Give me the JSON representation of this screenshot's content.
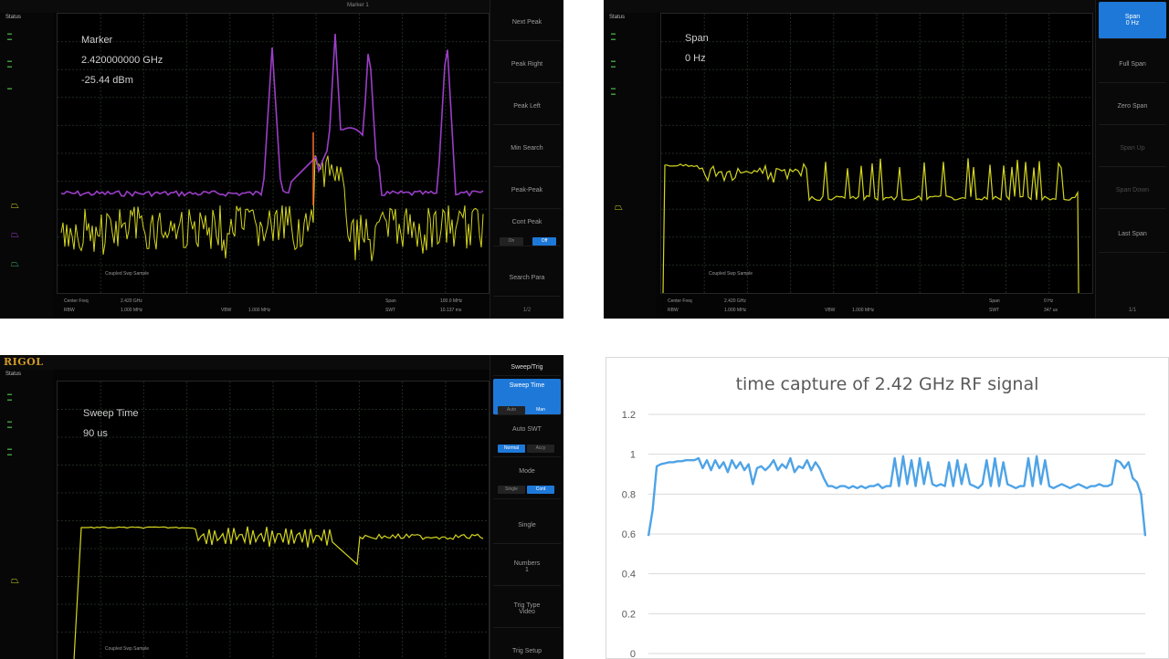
{
  "scope1": {
    "status": "Status",
    "overlay": [
      "Marker",
      "2.420000000 GHz",
      "-25.44 dBm"
    ],
    "menu": [
      "Next Peak",
      "Peak Right",
      "Peak Left",
      "Min Search",
      "Peak-Peak",
      "Cont Peak",
      "Search Para"
    ],
    "toggle": [
      "On",
      "Off"
    ],
    "page": "1/2",
    "center_label": "Center Freq",
    "center_value": "2.420 GHz",
    "span_label": "Span",
    "span_value": "100.0 MHz",
    "rbw_label": "RBW",
    "rbw_value": "1.000 MHz",
    "vbw_label": "VBW",
    "vbw_value": "1.000 MHz",
    "swt_label": "SWT",
    "swt_value": "10.137 ms",
    "note": "Coupled Swp   Sample",
    "marker1": "Marker 1",
    "trace_colors": {
      "max_hold": "#9b3ec8",
      "live": "#d4d61e",
      "marker": "#ff6a2a"
    }
  },
  "scope2": {
    "status": "Status",
    "overlay": [
      "Span",
      "0 Hz"
    ],
    "menu": [
      "Span",
      "Full Span",
      "Zero Span",
      "Span Up",
      "Span Down",
      "Last Span"
    ],
    "menu_sub": "0 Hz",
    "page": "1/1",
    "center_label": "Center Freq",
    "center_value": "2.420 GHz",
    "span_label": "Span",
    "span_value": "0 Hz",
    "rbw_label": "RBW",
    "rbw_value": "1.000 MHz",
    "vbw_label": "VBW",
    "vbw_value": "1.000 MHz",
    "swt_label": "SWT",
    "swt_value": "347 us",
    "note": "Coupled Swp   Sample",
    "trace_color": "#d4d61e"
  },
  "scope3": {
    "brand": "RIGOL",
    "status": "Status",
    "overlay": [
      "Sweep Time",
      "90 us"
    ],
    "menu": [
      "Sweep/Trig",
      "Sweep Time",
      "Auto SWT",
      "Mode",
      "Single",
      "Numbers",
      "Trig Type",
      "Trig Setup"
    ],
    "sweep_time_toggle": [
      "Auto",
      "Man"
    ],
    "auto_swt_toggle": [
      "Normal",
      "Accy"
    ],
    "mode_toggle": [
      "Single",
      "Cont"
    ],
    "numbers_value": "1",
    "trig_type_value": "Video",
    "note": "Coupled Swp   Sample",
    "trace_color": "#d4d61e"
  },
  "chart_data": {
    "type": "line",
    "title": "time capture of 2.42 GHz RF signal",
    "xlabel": "",
    "ylabel": "",
    "ylim": [
      0,
      1.2
    ],
    "yticks": [
      0,
      0.2,
      0.4,
      0.6,
      0.8,
      1,
      1.2
    ],
    "ytick_labels": [
      "0",
      "0.2",
      "0.4",
      "0.6",
      "0.8",
      "1",
      "1.2"
    ],
    "grid": true,
    "line_color": "#4ea3e6",
    "series": [
      {
        "values": [
          0.59,
          0.72,
          0.94,
          0.95,
          0.955,
          0.96,
          0.96,
          0.965,
          0.965,
          0.97,
          0.97,
          0.97,
          0.98,
          0.93,
          0.97,
          0.92,
          0.97,
          0.93,
          0.96,
          0.91,
          0.97,
          0.93,
          0.96,
          0.92,
          0.95,
          0.85,
          0.93,
          0.94,
          0.92,
          0.94,
          0.97,
          0.92,
          0.95,
          0.93,
          0.98,
          0.91,
          0.94,
          0.93,
          0.97,
          0.92,
          0.96,
          0.93,
          0.88,
          0.84,
          0.84,
          0.83,
          0.84,
          0.84,
          0.83,
          0.84,
          0.83,
          0.84,
          0.83,
          0.84,
          0.84,
          0.85,
          0.83,
          0.84,
          0.84,
          0.98,
          0.84,
          0.99,
          0.85,
          0.97,
          0.84,
          0.98,
          0.85,
          0.96,
          0.85,
          0.84,
          0.85,
          0.84,
          0.96,
          0.84,
          0.97,
          0.85,
          0.95,
          0.85,
          0.84,
          0.83,
          0.85,
          0.97,
          0.84,
          0.98,
          0.84,
          0.96,
          0.85,
          0.84,
          0.83,
          0.84,
          0.84,
          0.98,
          0.84,
          0.99,
          0.85,
          0.97,
          0.84,
          0.83,
          0.84,
          0.85,
          0.84,
          0.83,
          0.84,
          0.85,
          0.84,
          0.83,
          0.84,
          0.84,
          0.85,
          0.84,
          0.84,
          0.85,
          0.97,
          0.96,
          0.93,
          0.96,
          0.88,
          0.86,
          0.8,
          0.59
        ]
      }
    ]
  }
}
